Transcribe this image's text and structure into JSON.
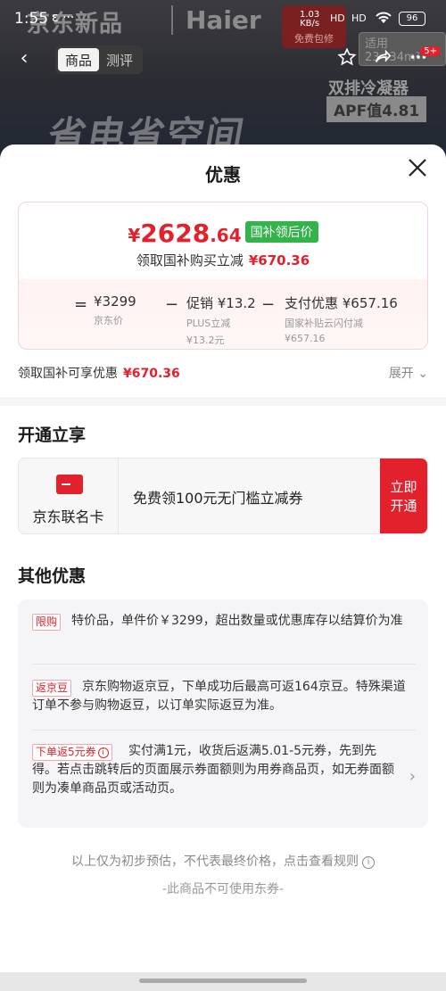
{
  "status_bar": {
    "time": "1:55",
    "notif": "ε ···",
    "rate_top": "1.03",
    "rate_bottom": "KB/s",
    "sig1": "HD",
    "sig2": "HD",
    "battery": "96"
  },
  "background": {
    "brand_left": "京东新品",
    "brand_right": "Haier",
    "slogan": "省电省空间",
    "feature": "双排冷凝器",
    "apf": "APF值4.81",
    "promo_label": "免费包修",
    "fit_label": "适用23~34m²"
  },
  "nav": {
    "back": "‹",
    "tabs": [
      {
        "label": "商品"
      },
      {
        "label": "测评"
      }
    ],
    "badge": "5+"
  },
  "sheet": {
    "title": "优惠",
    "close": "✕",
    "final_price": {
      "yen": "¥",
      "integer": "2628",
      "cents": ".64",
      "tag": "国补领后价"
    },
    "subsidy_line": {
      "label": "领取国补购买立减",
      "amount": "¥670.36"
    },
    "breakdown": {
      "eq": "=",
      "minus1": "−",
      "minus2": "−",
      "jd_price": {
        "value": "¥3299",
        "label": "京东价"
      },
      "promo": {
        "value": "促销 ¥13.2",
        "label": "PLUS立减",
        "sub": "¥13.2元"
      },
      "pay": {
        "value": "支付优惠 ¥657.16",
        "label": "国家补贴云闪付减",
        "sub": "¥657.16"
      }
    },
    "claim_row": {
      "label": "领取国补可享优惠",
      "amount": "¥670.36",
      "expand": "展开 ⌄"
    },
    "open_section": {
      "title": "开通立享",
      "card_name": "京东联名卡",
      "desc": "免费领100元无门槛立减券",
      "button_line1": "立即",
      "button_line2": "开通"
    },
    "other_section": {
      "title": "其他优惠",
      "offers": [
        {
          "tag": "限购",
          "text": "特价品，单件价￥3299，超出数量或优惠库存以结算价为准"
        },
        {
          "tag": "返京豆",
          "text": "京东购物返京豆，下单成功后最高可返164京豆。特殊渠道订单不参与购物返豆，以订单实际返豆为准。"
        },
        {
          "tag": "下单返5元券",
          "text": "实付满1元，收货后返满5.01-5元券，先到先得。若点击跳转后的页面展示券面额则为用券商品页，如无券面额则为凑单商品页或活动页。",
          "chevron": "›"
        }
      ]
    },
    "footer_note": "以上仅为初步预估，不代表最终价格，点击查看规则",
    "footer_note2": "-此商品不可使用东券-"
  },
  "colors": {
    "accent_red": "#e3212c",
    "tag_green": "#34b34a"
  }
}
